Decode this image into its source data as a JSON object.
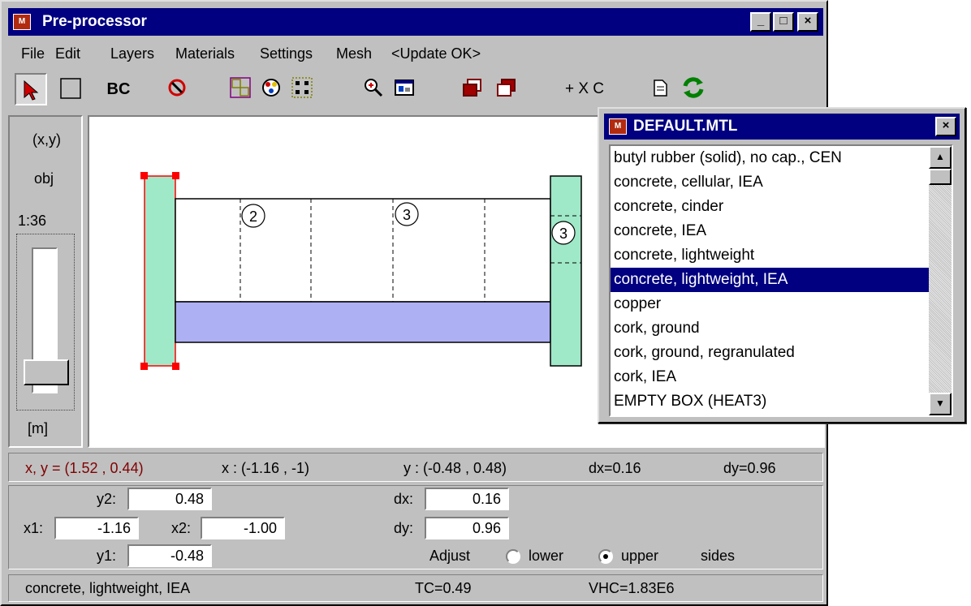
{
  "window": {
    "title": "Pre-processor",
    "minimize": "_",
    "maximize": "□",
    "close": "×"
  },
  "menu": [
    "File",
    "Edit",
    "Layers",
    "Materials",
    "Settings",
    "Mesh",
    "<Update OK>"
  ],
  "toolbar": {
    "bc_label": "BC",
    "text_tools": "+ X C"
  },
  "left_panel": {
    "coord": "(x,y)",
    "obj": "obj",
    "scale": "1:36",
    "unit": "[m]"
  },
  "canvas": {
    "layer_labels": [
      "2",
      "3",
      "3"
    ]
  },
  "coord_bar": {
    "xy": "x, y = (1.52 ,  0.44)",
    "x_range": "x :  (-1.16 ,  -1)",
    "y_range": "y :  (-0.48 ,  0.48)",
    "dx": "dx=0.16",
    "dy": "dy=0.96"
  },
  "edit": {
    "y2_label": "y2:",
    "y2": "0.48",
    "x1_label": "x1:",
    "x1": "-1.16",
    "x2_label": "x2:",
    "x2": "-1.00",
    "y1_label": "y1:",
    "y1": "-0.48",
    "dx_label": "dx:",
    "dx": "0.16",
    "dy_label": "dy:",
    "dy": "0.96",
    "adjust": "Adjust",
    "lower": "lower",
    "upper": "upper",
    "sides": "sides",
    "selected": "upper"
  },
  "status": {
    "material": "concrete, lightweight, IEA",
    "tc": "TC=0.49",
    "vhc": "VHC=1.83E6"
  },
  "materials_popup": {
    "title": "DEFAULT.MTL",
    "items": [
      "butyl rubber (solid), no cap., CEN",
      "concrete, cellular, IEA",
      "concrete, cinder",
      "concrete, IEA",
      "concrete, lightweight",
      "concrete, lightweight, IEA",
      "copper",
      "cork, ground",
      "cork, ground, regranulated",
      "cork, IEA",
      "EMPTY BOX (HEAT3)"
    ],
    "selected_index": 5
  },
  "colors": {
    "title_bar": "#000080",
    "wall_fill": "#9fe8c8",
    "slab_fill": "#aeb0f4",
    "selection": "#ff0000",
    "coord_text": "#800000"
  }
}
